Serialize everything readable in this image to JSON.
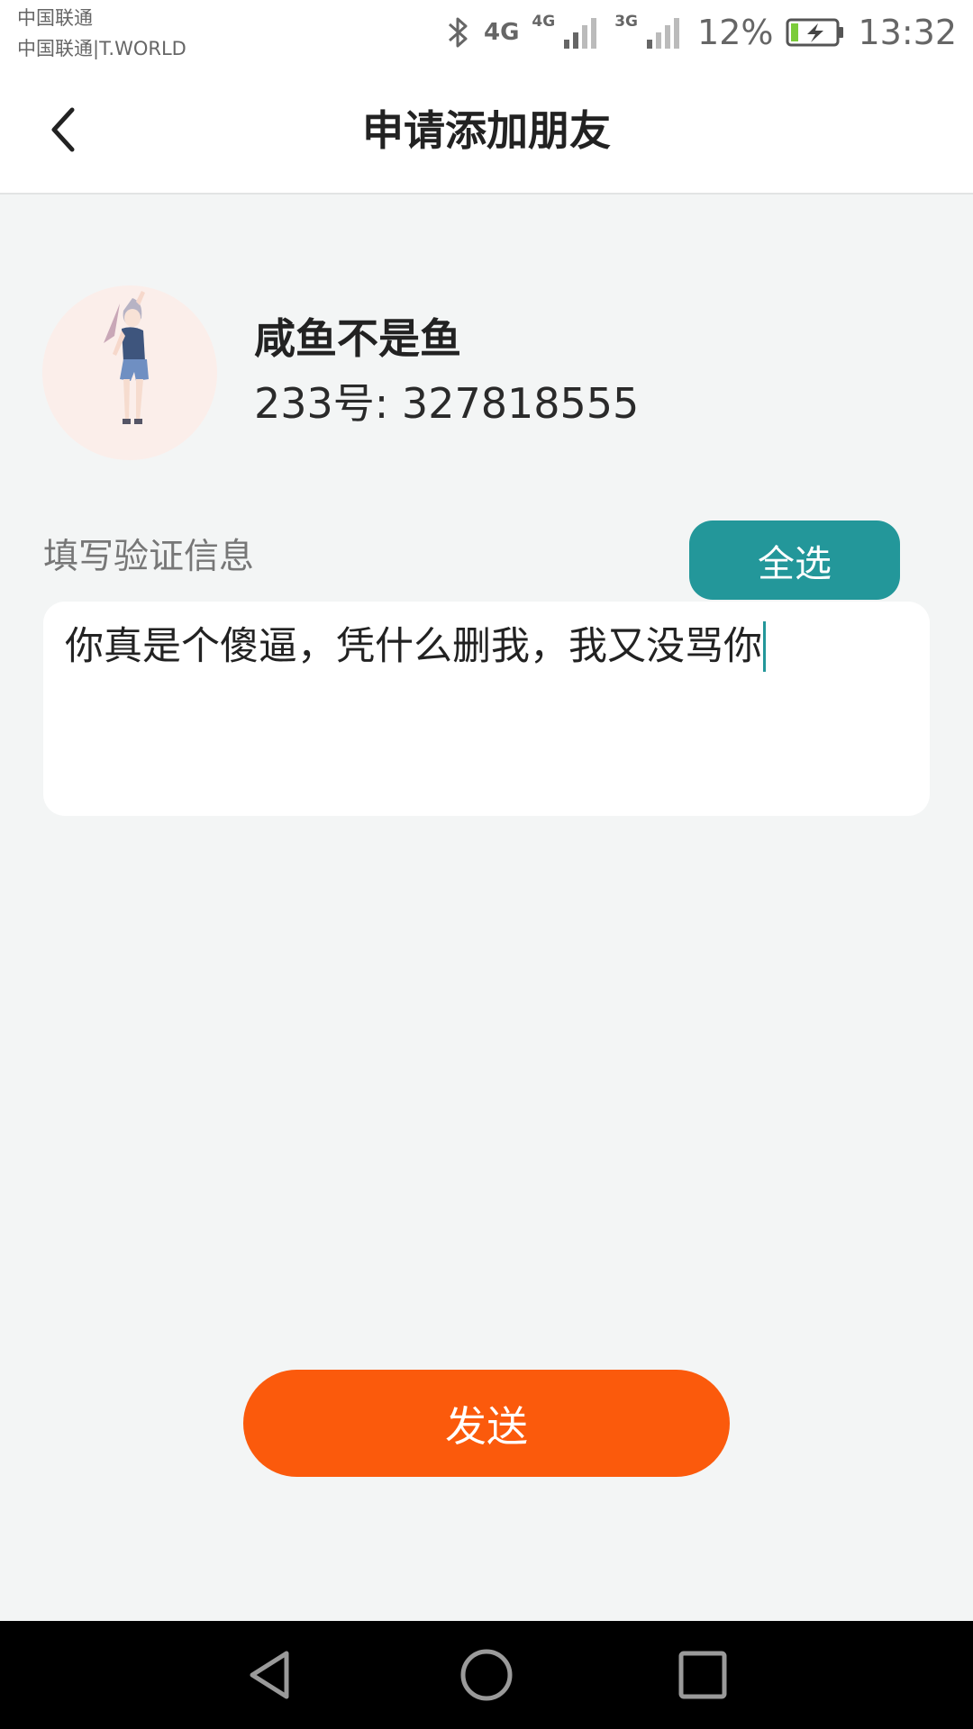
{
  "status_bar": {
    "carrier_primary": "中国联通",
    "carrier_secondary": "中国联通|T.WORLD",
    "network_1": "4G",
    "network_2": "4G",
    "network_3": "3G",
    "battery_percent": "12%",
    "time": "13:32",
    "icons": [
      "bluetooth-icon",
      "signal-icon",
      "battery-charging-icon"
    ]
  },
  "header": {
    "title": "申请添加朋友",
    "back_icon": "chevron-left-icon"
  },
  "profile": {
    "avatar_icon": "anime-character-avatar",
    "name": "咸鱼不是鱼",
    "id_label": "233号: ",
    "id_value": "327818555"
  },
  "verification": {
    "label": "填写验证信息",
    "select_all_label": "全选",
    "message": "你真是个傻逼，凭什么删我，我又没骂你"
  },
  "actions": {
    "send_label": "发送"
  },
  "nav_bar": {
    "icons": [
      "back-triangle-icon",
      "home-circle-icon",
      "recents-square-icon"
    ]
  },
  "colors": {
    "accent_teal": "#23979a",
    "send_orange": "#fb5a0c",
    "background": "#f3f5f5"
  }
}
